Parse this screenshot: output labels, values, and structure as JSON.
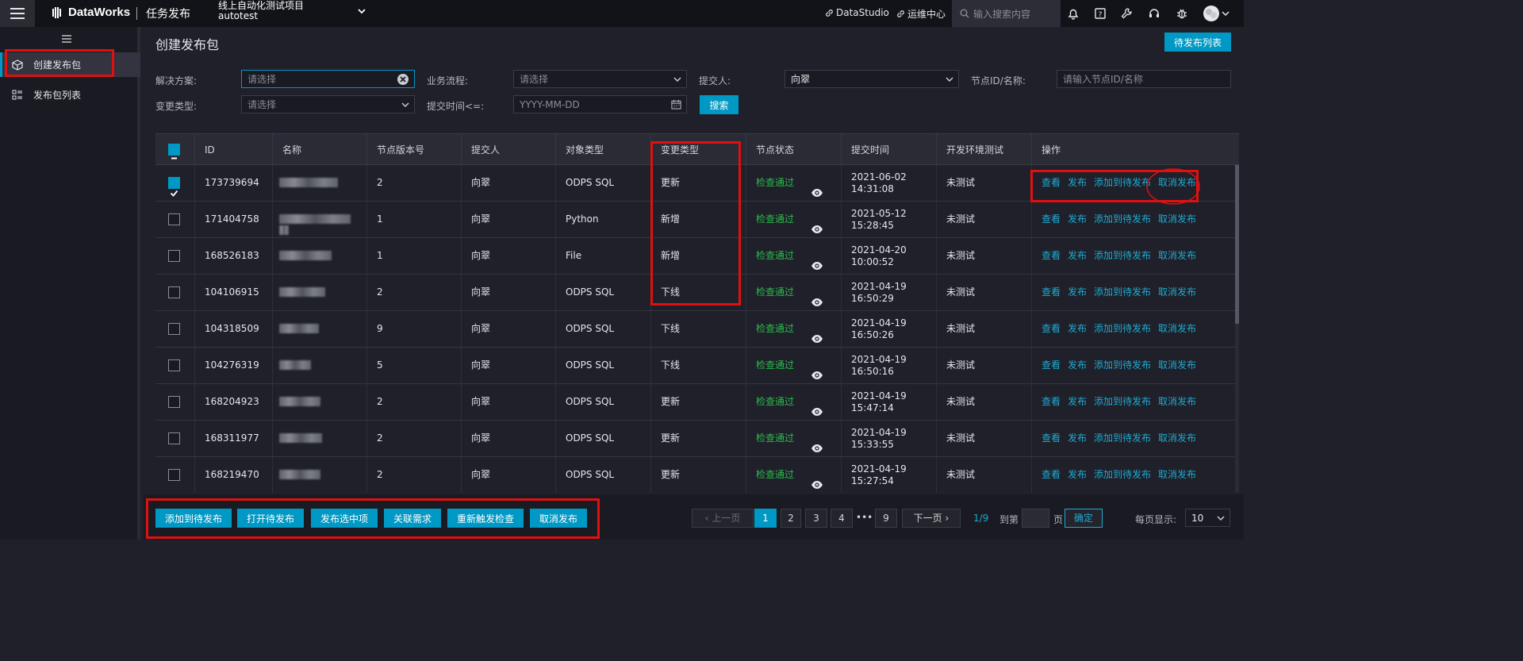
{
  "topbar": {
    "logo": "DataWorks",
    "module": "任务发布",
    "project_line1": "线上自动化测试项目",
    "project_line2": "autotest",
    "links": [
      "DataStudio",
      "运维中心"
    ],
    "search_placeholder": "输入搜索内容"
  },
  "sidebar": {
    "items": [
      {
        "label": "创建发布包",
        "icon": "package-add-icon"
      },
      {
        "label": "发布包列表",
        "icon": "list-icon"
      }
    ]
  },
  "page": {
    "title": "创建发布包",
    "pending_list_button": "待发布列表"
  },
  "filters": {
    "solution_label": "解决方案:",
    "solution_value": "请选择",
    "flow_label": "业务流程:",
    "flow_value": "请选择",
    "submitter_label": "提交人:",
    "submitter_value": "向翠",
    "node_label": "节点ID/名称:",
    "node_placeholder": "请输入节点ID/名称",
    "change_type_label": "变更类型:",
    "change_type_value": "请选择",
    "submit_time_label": "提交时间<=:",
    "submit_time_placeholder": "YYYY-MM-DD",
    "search_button": "搜索"
  },
  "table": {
    "headers": [
      "ID",
      "名称",
      "节点版本号",
      "提交人",
      "对象类型",
      "变更类型",
      "节点状态",
      "提交时间",
      "开发环境测试",
      "操作"
    ],
    "ops": [
      "查看",
      "发布",
      "添加到待发布",
      "取消发布"
    ],
    "rows": [
      {
        "checked": true,
        "id": "173739694",
        "version": "2",
        "submitter": "向翠",
        "type": "ODPS SQL",
        "change": "更新",
        "status": "检查通过",
        "date": "2021-06-02",
        "time": "14:31:08",
        "test": "未测试"
      },
      {
        "checked": false,
        "id": "171404758",
        "version": "1",
        "submitter": "向翠",
        "type": "Python",
        "change": "新增",
        "status": "检查通过",
        "date": "2021-05-12",
        "time": "15:28:45",
        "test": "未测试"
      },
      {
        "checked": false,
        "id": "168526183",
        "version": "1",
        "submitter": "向翠",
        "type": "File",
        "change": "新增",
        "status": "检查通过",
        "date": "2021-04-20",
        "time": "10:00:52",
        "test": "未测试"
      },
      {
        "checked": false,
        "id": "104106915",
        "version": "2",
        "submitter": "向翠",
        "type": "ODPS SQL",
        "change": "下线",
        "status": "检查通过",
        "date": "2021-04-19",
        "time": "16:50:29",
        "test": "未测试"
      },
      {
        "checked": false,
        "id": "104318509",
        "version": "9",
        "submitter": "向翠",
        "type": "ODPS SQL",
        "change": "下线",
        "status": "检查通过",
        "date": "2021-04-19",
        "time": "16:50:26",
        "test": "未测试"
      },
      {
        "checked": false,
        "id": "104276319",
        "version": "5",
        "submitter": "向翠",
        "type": "ODPS SQL",
        "change": "下线",
        "status": "检查通过",
        "date": "2021-04-19",
        "time": "16:50:16",
        "test": "未测试"
      },
      {
        "checked": false,
        "id": "168204923",
        "version": "2",
        "submitter": "向翠",
        "type": "ODPS SQL",
        "change": "更新",
        "status": "检查通过",
        "date": "2021-04-19",
        "time": "15:47:14",
        "test": "未测试"
      },
      {
        "checked": false,
        "id": "168311977",
        "version": "2",
        "submitter": "向翠",
        "type": "ODPS SQL",
        "change": "更新",
        "status": "检查通过",
        "date": "2021-04-19",
        "time": "15:33:55",
        "test": "未测试"
      },
      {
        "checked": false,
        "id": "168219470",
        "version": "2",
        "submitter": "向翠",
        "type": "ODPS SQL",
        "change": "更新",
        "status": "检查通过",
        "date": "2021-04-19",
        "time": "15:27:54",
        "test": "未测试"
      }
    ]
  },
  "bottom": {
    "actions": [
      "添加到待发布",
      "打开待发布",
      "发布选中项",
      "关联需求",
      "重新触发检查",
      "取消发布"
    ],
    "prev": "上一页",
    "next": "下一页",
    "pages": [
      "1",
      "2",
      "3",
      "4",
      "•••",
      "9"
    ],
    "current_page": "1",
    "page_info": "1/9",
    "goto_label": "到第",
    "page_unit": "页",
    "confirm": "确定",
    "per_page_label": "每页显示:",
    "per_page_value": "10"
  },
  "colors": {
    "accent": "#0098c4",
    "ok": "#2dba4e",
    "link": "#1faad1",
    "highlight": "#e01010"
  }
}
